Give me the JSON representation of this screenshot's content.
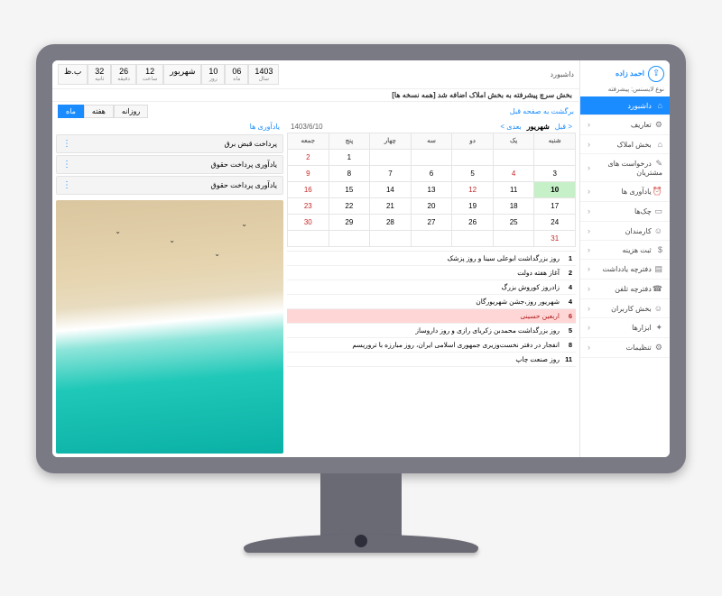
{
  "user": {
    "name": "احمد زاده",
    "license_label": "نوع لایسنس:",
    "license_value": "پیشرفته"
  },
  "breadcrumb": "داشبورد",
  "datetime": {
    "year_lbl": "سال",
    "year": "1403",
    "month_lbl": "ماه",
    "month": "06",
    "day_lbl": "روز",
    "day": "10",
    "monthname_lbl": "",
    "monthname": "شهریور",
    "hour_lbl": "ساعت",
    "hour": "12",
    "min_lbl": "دقیقه",
    "min": "26",
    "sec_lbl": "ثانیه",
    "sec": "32",
    "ampm_lbl": "",
    "ampm": "ب.ظ"
  },
  "banner": "بخش سرچ پیشرفته به بخش املاک اضافه شد [همه نسخه ها]",
  "back_link": "برگشت به صفحه قبل",
  "view_tabs": {
    "day": "روزانه",
    "week": "هفته",
    "month": "ماه"
  },
  "nav": [
    {
      "label": "داشبورد",
      "icon": "⌂",
      "active": true,
      "chev": false
    },
    {
      "label": "تعاریف",
      "icon": "⚙",
      "chev": true
    },
    {
      "label": "بخش املاک",
      "icon": "⌂",
      "chev": true
    },
    {
      "label": "درخواست های مشتریان",
      "icon": "✎",
      "chev": true
    },
    {
      "label": "یادآوری ها",
      "icon": "⏰",
      "chev": true
    },
    {
      "label": "چک‌ها",
      "icon": "▭",
      "chev": true
    },
    {
      "label": "کارمندان",
      "icon": "☺",
      "chev": true
    },
    {
      "label": "ثبت هزینه",
      "icon": "$",
      "chev": true
    },
    {
      "label": "دفترچه یادداشت",
      "icon": "▤",
      "chev": true
    },
    {
      "label": "دفترچه تلفن",
      "icon": "☎",
      "chev": true
    },
    {
      "label": "بخش کاربران",
      "icon": "☺",
      "chev": true
    },
    {
      "label": "ابزارها",
      "icon": "✦",
      "chev": true
    },
    {
      "label": "تنظیمات",
      "icon": "⚙",
      "chev": true
    }
  ],
  "calendar": {
    "title": "شهریور",
    "date_str": "1403/6/10",
    "prev": "< قبل",
    "next": "بعدی >",
    "dow": [
      "شنبه",
      "یک",
      "دو",
      "سه",
      "چهار",
      "پنج",
      "جمعه"
    ],
    "weeks": [
      [
        "",
        "",
        "",
        "",
        "",
        "1",
        "2"
      ],
      [
        "3",
        "4",
        "5",
        "6",
        "7",
        "8",
        "9"
      ],
      [
        "10",
        "11",
        "12",
        "13",
        "14",
        "15",
        "16"
      ],
      [
        "17",
        "18",
        "19",
        "20",
        "21",
        "22",
        "23"
      ],
      [
        "24",
        "25",
        "26",
        "27",
        "28",
        "29",
        "30"
      ],
      [
        "31",
        "",
        "",
        "",
        "",
        "",
        ""
      ]
    ],
    "today": "10",
    "red_days": [
      "2",
      "4",
      "9",
      "12",
      "16",
      "23",
      "30",
      "31"
    ]
  },
  "events": [
    {
      "d": "1",
      "t": "روز بزرگداشت ابوعلی سینا و روز پزشک"
    },
    {
      "d": "2",
      "t": "آغاز هفته دولت"
    },
    {
      "d": "4",
      "t": "زادروز کوروش بزرگ"
    },
    {
      "d": "4",
      "t": "شهریور روز،جشن شهریورگان"
    },
    {
      "d": "6",
      "t": "اربعین حسینی",
      "holiday": true
    },
    {
      "d": "5",
      "t": "روز بزرگداشت محمدبن زکریای رازی و روز داروساز"
    },
    {
      "d": "8",
      "t": "انفجار در دفتر نخست‌وزیری جمهوری اسلامی ایران، روز مبارزه با تروریسم"
    },
    {
      "d": "11",
      "t": "روز صنعت چاپ"
    }
  ],
  "reminders": {
    "tab": "یادآوری ها",
    "items": [
      "پرداخت قبض برق",
      "یادآوری پرداخت حقوق",
      "یادآوری پرداخت حقوق"
    ]
  }
}
